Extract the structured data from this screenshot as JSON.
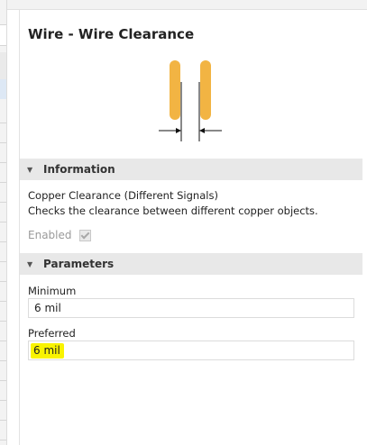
{
  "panel": {
    "title": "Wire - Wire Clearance"
  },
  "diagram": {
    "wire_color": "#f2b443",
    "icon": "wire-clearance-diagram-icon"
  },
  "sections": {
    "information": {
      "label": "Information",
      "description_line1": "Copper Clearance (Different Signals)",
      "description_line2": "Checks the clearance between different copper objects.",
      "enabled_label": "Enabled",
      "enabled": true
    },
    "parameters": {
      "label": "Parameters",
      "minimum_label": "Minimum",
      "minimum_value": "6 mil",
      "preferred_label": "Preferred",
      "preferred_value": "6 mil"
    }
  },
  "colors": {
    "highlight": "#f9f300",
    "section_header_bg": "#e8e8e8"
  }
}
